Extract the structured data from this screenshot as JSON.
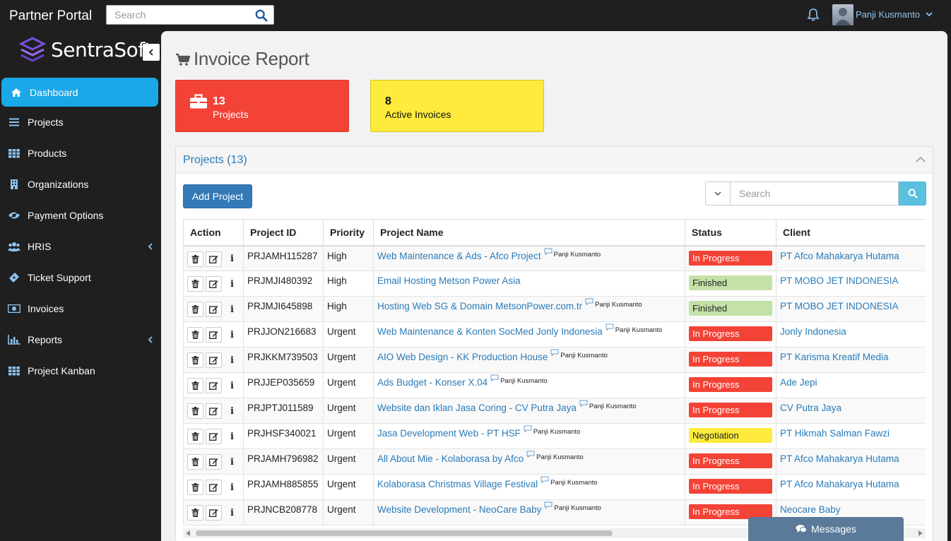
{
  "topbar": {
    "brand": "Partner Portal",
    "search_placeholder": "Search",
    "user_name": "Panji Kusmanto"
  },
  "sidebar": {
    "logo_text": "SentraSoft",
    "items": [
      {
        "label": "Dashboard",
        "icon": "home-icon",
        "active": true
      },
      {
        "label": "Projects",
        "icon": "list-icon"
      },
      {
        "label": "Products",
        "icon": "grid-icon"
      },
      {
        "label": "Organizations",
        "icon": "building-icon"
      },
      {
        "label": "Payment Options",
        "icon": "eye-icon"
      },
      {
        "label": "HRIS",
        "icon": "users-icon",
        "has_submenu": true
      },
      {
        "label": "Ticket Support",
        "icon": "ticket-icon"
      },
      {
        "label": "Invoices",
        "icon": "money-icon"
      },
      {
        "label": "Reports",
        "icon": "bar-chart-icon",
        "has_submenu": true
      },
      {
        "label": "Project Kanban",
        "icon": "grid-icon"
      }
    ]
  },
  "page": {
    "title": "Invoice Report"
  },
  "cards": {
    "projects": {
      "count": "13",
      "label": "Projects",
      "color": "#f34336"
    },
    "invoices": {
      "count": "8",
      "label": "Active Invoices",
      "color": "#ffeb3b"
    }
  },
  "panel": {
    "title": "Projects (13)",
    "add_button": "Add Project",
    "search_placeholder": "Search",
    "columns": [
      "Action",
      "Project ID",
      "Priority",
      "Project Name",
      "Status",
      "Client"
    ]
  },
  "rows": [
    {
      "id": "PRJAMH115287",
      "priority": "High",
      "name": "Web Maintenance & Ads - Afco Project",
      "owner": "Panji Kusmanto",
      "status": "In Progress",
      "client": "PT Afco Mahakarya Hutama"
    },
    {
      "id": "PRJMJI480392",
      "priority": "High",
      "name": "Email Hosting Metson Power Asia",
      "owner": "",
      "status": "Finished",
      "client": "PT MOBO JET INDONESIA"
    },
    {
      "id": "PRJMJI645898",
      "priority": "High",
      "name": "Hosting Web SG & Domain MetsonPower.com.tr",
      "owner": "Panji Kusmanto",
      "status": "Finished",
      "client": "PT MOBO JET INDONESIA"
    },
    {
      "id": "PRJJON216683",
      "priority": "Urgent",
      "name": "Web Maintenance & Konten SocMed Jonly Indonesia",
      "owner": "Panji Kusmanto",
      "status": "In Progress",
      "client": "Jonly Indonesia"
    },
    {
      "id": "PRJKKM739503",
      "priority": "Urgent",
      "name": "AIO Web Design - KK Production House",
      "owner": "Panji Kusmanto",
      "status": "In Progress",
      "client": "PT Karisma Kreatif Media"
    },
    {
      "id": "PRJJEP035659",
      "priority": "Urgent",
      "name": "Ads Budget - Konser X.04",
      "owner": "Panji Kusmanto",
      "status": "In Progress",
      "client": "Ade Jepi"
    },
    {
      "id": "PRJPTJ011589",
      "priority": "Urgent",
      "name": "Website dan Iklan Jasa Coring - CV Putra Jaya",
      "owner": "Panji Kusmanto",
      "status": "In Progress",
      "client": "CV Putra Jaya"
    },
    {
      "id": "PRJHSF340021",
      "priority": "Urgent",
      "name": "Jasa Development Web - PT HSF",
      "owner": "Panji Kusmanto",
      "status": "Negotiation",
      "client": "PT Hikmah Salman Fawzi"
    },
    {
      "id": "PRJAMH796982",
      "priority": "Urgent",
      "name": "All About Mie - Kolaborasa by Afco",
      "owner": "Panji Kusmanto",
      "status": "In Progress",
      "client": "PT Afco Mahakarya Hutama"
    },
    {
      "id": "PRJAMH885855",
      "priority": "Urgent",
      "name": "Kolaborasa Christmas Village Festival",
      "owner": "Panji Kusmanto",
      "status": "In Progress",
      "client": "PT Afco Mahakarya Hutama"
    },
    {
      "id": "PRJNCB208778",
      "priority": "Urgent",
      "name": "Website Development - NeoCare Baby",
      "owner": "Panji Kusmanto",
      "status": "In Progress",
      "client": "Neocare Baby"
    }
  ],
  "messages": {
    "label": "Messages"
  },
  "colors": {
    "accent": "#1ba8e8",
    "link": "#2a7bb8",
    "in_progress": "#f34336",
    "finished": "#c4e2a8",
    "negotiation": "#ffeb3b"
  }
}
